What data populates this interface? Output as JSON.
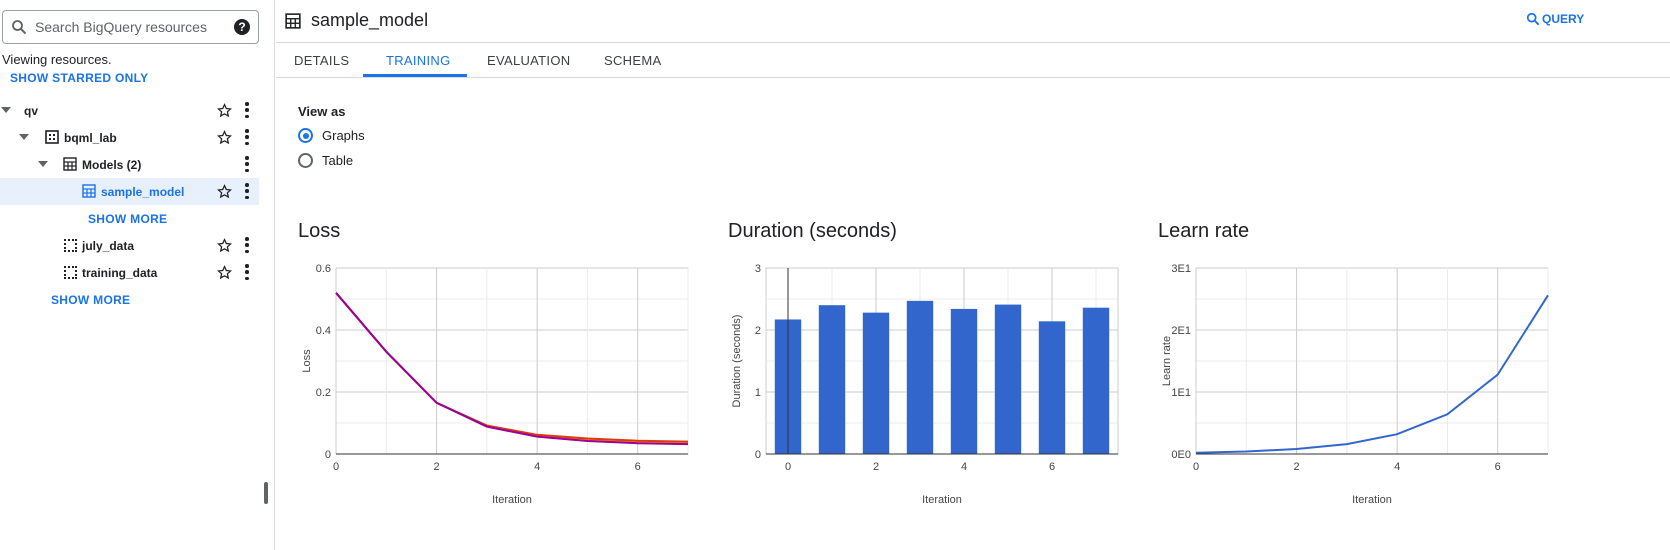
{
  "sidebar": {
    "search_placeholder": "Search BigQuery resources",
    "viewing_text": "Viewing resources.",
    "show_starred": "SHOW STARRED ONLY",
    "tree": {
      "project": "qv",
      "dataset": "bqml_lab",
      "models_group": "Models (2)",
      "model": "sample_model",
      "show_more_models": "SHOW MORE",
      "table1": "july_data",
      "table2": "training_data",
      "show_more_tables": "SHOW MORE"
    }
  },
  "header": {
    "title": "sample_model",
    "query_label": "QUERY"
  },
  "tabs": [
    "DETAILS",
    "TRAINING",
    "EVALUATION",
    "SCHEMA"
  ],
  "active_tab": "TRAINING",
  "view_as": {
    "label": "View as",
    "options": [
      "Graphs",
      "Table"
    ],
    "selected": "Graphs"
  },
  "colors": {
    "accent": "#1a73e8",
    "bar": "#3366cc",
    "loss_train": "#dc3912",
    "loss_eval": "#ff9900",
    "loss_overlay": "#990099"
  },
  "chart_data": [
    {
      "type": "line",
      "title": "Loss",
      "xlabel": "Iteration",
      "ylabel": "Loss",
      "x": [
        0,
        1,
        2,
        3,
        4,
        5,
        6,
        7
      ],
      "series": [
        {
          "values": [
            0.52,
            0.33,
            0.165,
            0.09,
            0.058,
            0.045,
            0.038,
            0.035
          ]
        },
        {
          "values": [
            0.52,
            0.33,
            0.165,
            0.092,
            0.062,
            0.05,
            0.043,
            0.04
          ]
        },
        {
          "values": [
            0.52,
            0.33,
            0.165,
            0.088,
            0.056,
            0.042,
            0.035,
            0.032
          ]
        }
      ],
      "xlim": [
        0,
        7
      ],
      "ylim": [
        0,
        0.6
      ],
      "xticks": [
        "0",
        "2",
        "4",
        "6"
      ],
      "yticks": [
        "0",
        "0.2",
        "0.4",
        "0.6"
      ],
      "grid": true
    },
    {
      "type": "bar",
      "title": "Duration (seconds)",
      "xlabel": "Iteration",
      "ylabel": "Duration (seconds)",
      "x": [
        0,
        1,
        2,
        3,
        4,
        5,
        6,
        7
      ],
      "values": [
        2.17,
        2.4,
        2.28,
        2.47,
        2.34,
        2.41,
        2.14,
        2.36
      ],
      "xlim": [
        -0.5,
        7.5
      ],
      "ylim": [
        0,
        3
      ],
      "xticks": [
        "0",
        "2",
        "4",
        "6"
      ],
      "yticks": [
        "0",
        "1",
        "2",
        "3"
      ],
      "grid": true
    },
    {
      "type": "line",
      "title": "Learn rate",
      "xlabel": "Iteration",
      "ylabel": "Learn rate",
      "x": [
        0,
        1,
        2,
        3,
        4,
        5,
        6,
        7
      ],
      "values": [
        0.2,
        0.4,
        0.8,
        1.6,
        3.2,
        6.4,
        12.8,
        25.6
      ],
      "xlim": [
        0,
        7
      ],
      "ylim": [
        0,
        30
      ],
      "xticks": [
        "0",
        "2",
        "4",
        "6"
      ],
      "yticks": [
        "0E0",
        "1E1",
        "2E1",
        "3E1"
      ],
      "grid": true
    }
  ]
}
